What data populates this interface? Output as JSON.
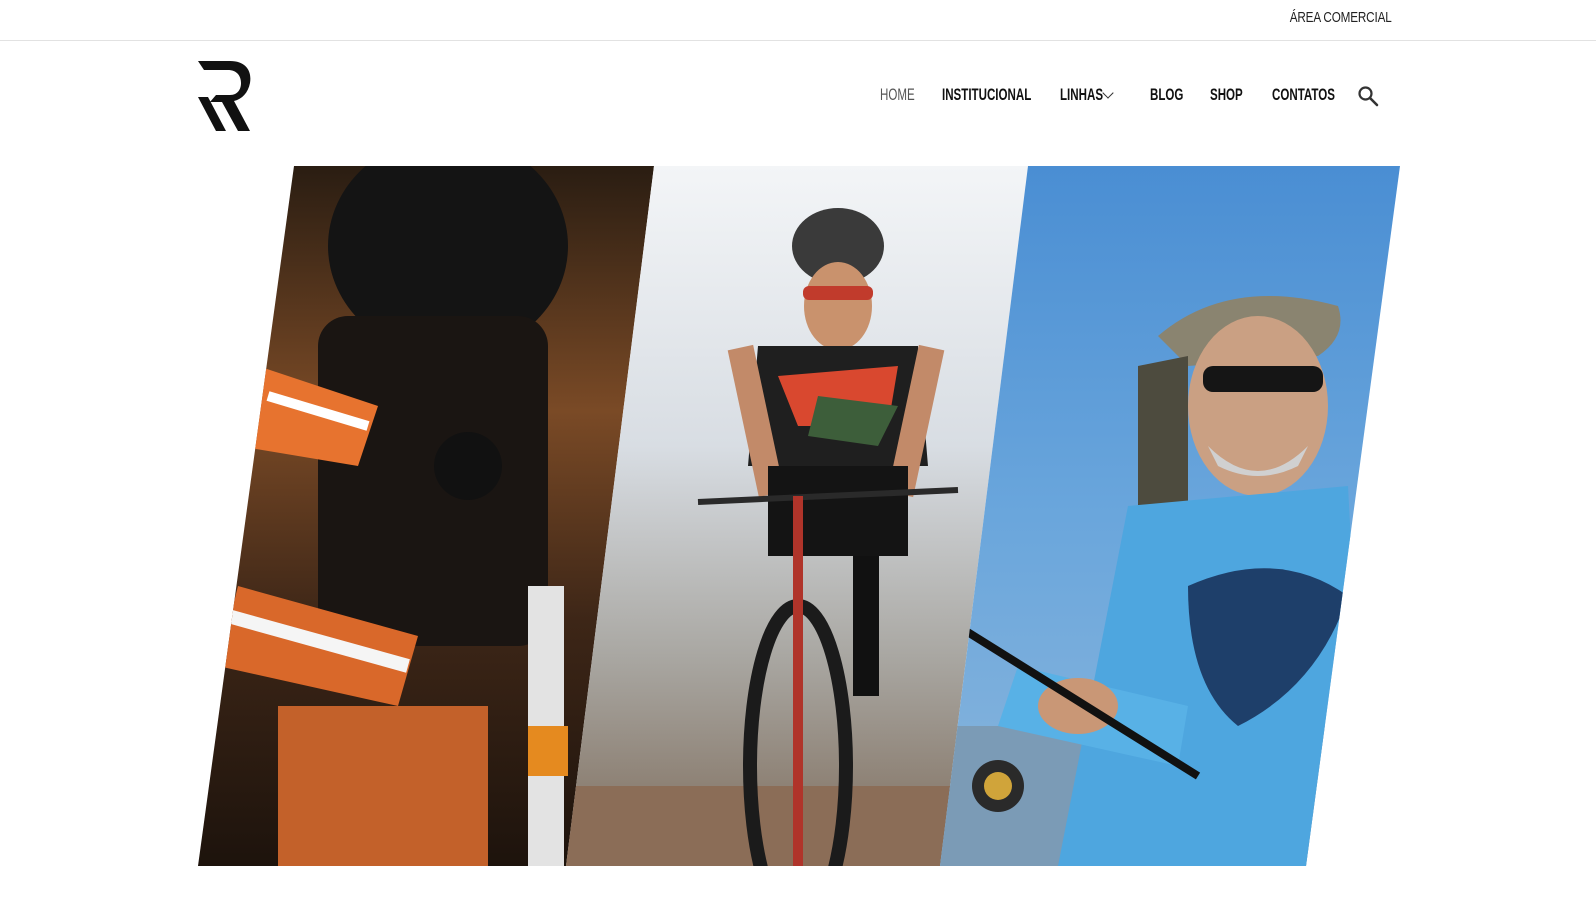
{
  "topbar": {
    "area_comercial": "Área Comercial"
  },
  "nav": {
    "home": "Home",
    "institucional": "Institucional",
    "linhas": "Linhas",
    "blog": "Blog",
    "shop": "Shop",
    "contatos": "Contatos"
  },
  "icons": {
    "search": "search-icon",
    "chevron": "chevron-down-icon",
    "logo": "r-logo"
  },
  "colors": {
    "text": "#111111",
    "nav_active": "#555555",
    "divider": "#e2e2e2"
  }
}
